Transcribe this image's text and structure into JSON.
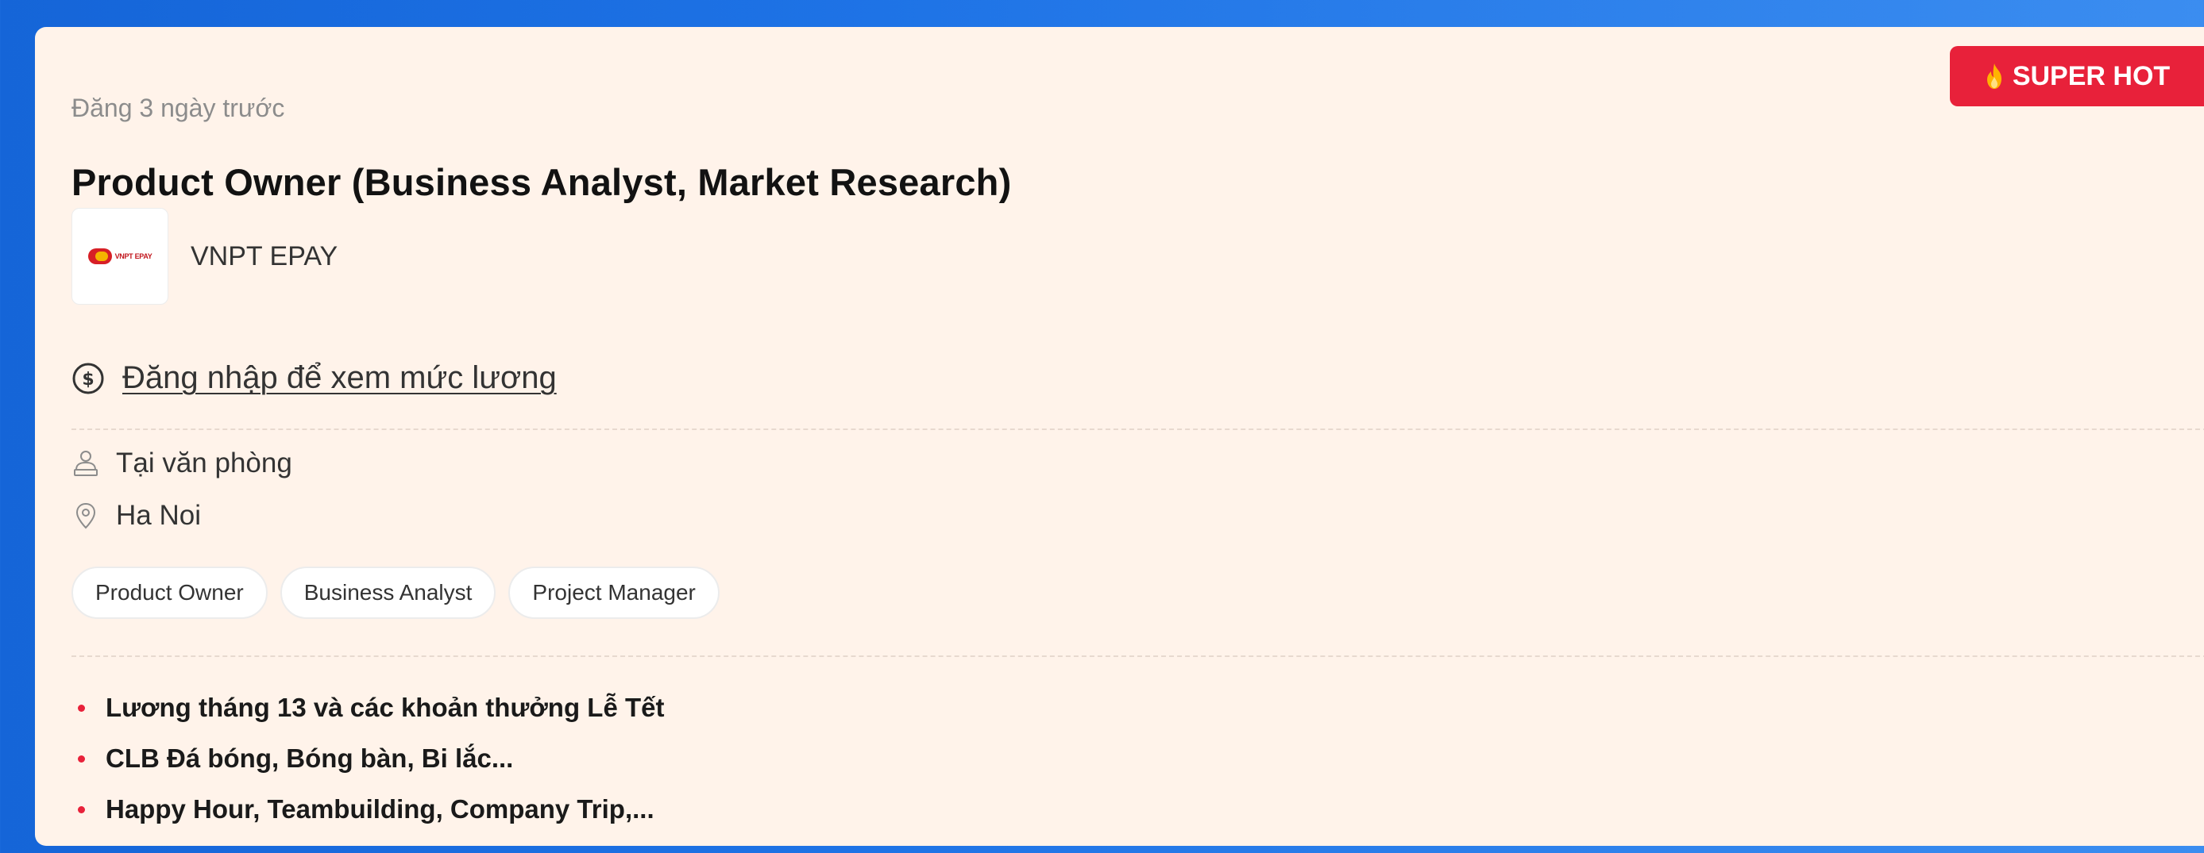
{
  "job": {
    "posted": "Đăng 3 ngày trước",
    "badge": "SUPER HOT",
    "title": "Product Owner (Business Analyst, Market Research)",
    "company": "VNPT EPAY",
    "company_logo_text": "VNPT EPAY",
    "salary_link": "Đăng nhập để xem mức lương",
    "work_mode": "Tại văn phòng",
    "location": "Ha Noi",
    "tags": [
      "Product Owner",
      "Business Analyst",
      "Project Manager"
    ],
    "benefits": [
      "Lương tháng 13 và các khoản thưởng Lễ Tết",
      "CLB Đá bóng, Bóng bàn, Bi lắc...",
      "Happy Hour, Teambuilding, Company Trip,..."
    ]
  },
  "icons": {
    "badge": "fire-icon",
    "salary": "dollar-circle-icon",
    "work_mode": "office-worker-icon",
    "location": "map-pin-icon"
  },
  "colors": {
    "background": "#1e73e6",
    "card": "#fff3ea",
    "badge": "#e8213a",
    "bullet": "#e8213a"
  }
}
